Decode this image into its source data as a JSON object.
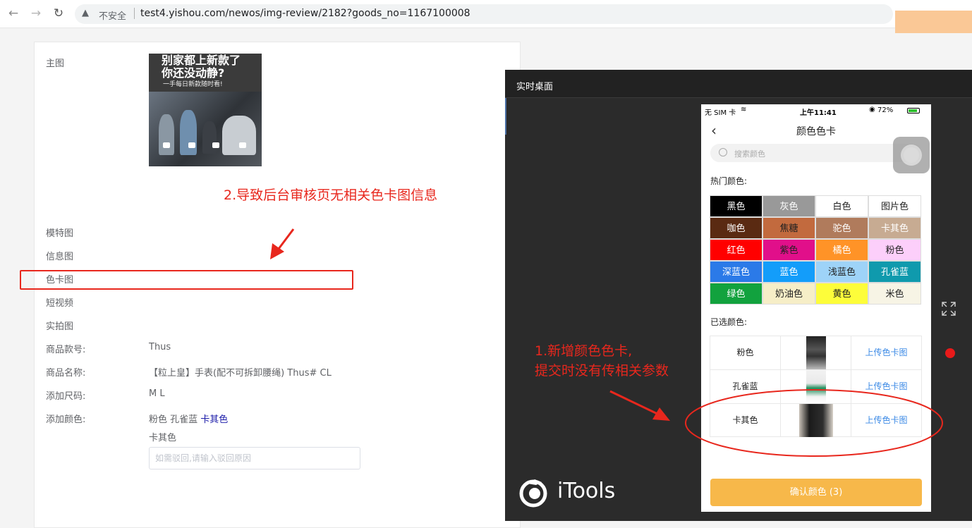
{
  "browser": {
    "back": "←",
    "forward": "→",
    "reload": "↻",
    "warning_icon": "▲",
    "security_text": "不安全",
    "url": "test4.yishou.com/newos/img-review/2182?goods_no=1167100008"
  },
  "review": {
    "labels": {
      "main_image": "主图",
      "model_image": "模特图",
      "info_image": "信息图",
      "color_card_image": "色卡图",
      "short_video": "短视频",
      "real_photo": "实拍图",
      "style_no": "商品款号:",
      "product_name": "商品名称:",
      "sizes": "添加尺码:",
      "colors": "添加颜色:"
    },
    "values": {
      "style_no": "Thus",
      "product_name": "【粒上皇】手表(配不可拆卸腰绳) Thus# CL",
      "sizes": "M L",
      "colors_plain": "粉色 孔雀蓝",
      "colors_highlight": "卡其色",
      "color_sub": "卡其色"
    },
    "main_image_text": {
      "line1": "别家都上新款了",
      "line2": "你还没动静?",
      "line3": "一手每日新款随时看!"
    },
    "reject_placeholder": "如需驳回,请输入驳回原因"
  },
  "annotations": {
    "note2": "2.导致后台审核页无相关色卡图信息",
    "note1_line1": "1.新增颜色色卡,",
    "note1_line2": "提交时没有传相关参数"
  },
  "remote": {
    "title": "实时桌面",
    "brand": "iTools"
  },
  "phone": {
    "status_left": "无 SIM 卡",
    "status_time": "上午11:41",
    "status_battery": "72%",
    "title": "颜色色卡",
    "back_icon": "‹",
    "search_placeholder": "搜索颜色",
    "hot_label": "热门颜色:",
    "selected_label": "已选颜色:",
    "swatches": [
      {
        "name": "黑色",
        "bg": "#000000",
        "fg": "#ffffff"
      },
      {
        "name": "灰色",
        "bg": "#999999",
        "fg": "#ffffff"
      },
      {
        "name": "白色",
        "bg": "#ffffff",
        "fg": "#222222"
      },
      {
        "name": "图片色",
        "bg": "#ffffff",
        "fg": "#222222"
      },
      {
        "name": "咖色",
        "bg": "#5a2a12",
        "fg": "#ffffff"
      },
      {
        "name": "焦糖",
        "bg": "#c26a3e",
        "fg": "#222222"
      },
      {
        "name": "驼色",
        "bg": "#b07b5c",
        "fg": "#ffffff"
      },
      {
        "name": "卡其色",
        "bg": "#c7ab92",
        "fg": "#ffffff"
      },
      {
        "name": "红色",
        "bg": "#ff0000",
        "fg": "#ffffff"
      },
      {
        "name": "紫色",
        "bg": "#e10f8a",
        "fg": "#222222"
      },
      {
        "name": "橘色",
        "bg": "#ff9327",
        "fg": "#ffffff"
      },
      {
        "name": "粉色",
        "bg": "#fccffa",
        "fg": "#222222"
      },
      {
        "name": "深蓝色",
        "bg": "#2b7ae8",
        "fg": "#ffffff"
      },
      {
        "name": "蓝色",
        "bg": "#139dfa",
        "fg": "#ffffff"
      },
      {
        "name": "浅蓝色",
        "bg": "#9ed3f8",
        "fg": "#222222"
      },
      {
        "name": "孔雀蓝",
        "bg": "#0f9aad",
        "fg": "#ffffff"
      },
      {
        "name": "绿色",
        "bg": "#12a23e",
        "fg": "#ffffff"
      },
      {
        "name": "奶油色",
        "bg": "#f6eec7",
        "fg": "#222222"
      },
      {
        "name": "黄色",
        "bg": "#fdfd3a",
        "fg": "#222222"
      },
      {
        "name": "米色",
        "bg": "#f7f4e5",
        "fg": "#222222"
      }
    ],
    "selected": [
      {
        "name": "粉色",
        "upload": "上传色卡图"
      },
      {
        "name": "孔雀蓝",
        "upload": "上传色卡图"
      },
      {
        "name": "卡其色",
        "upload": "上传色卡图"
      }
    ],
    "confirm": "确认颜色 (3)"
  }
}
